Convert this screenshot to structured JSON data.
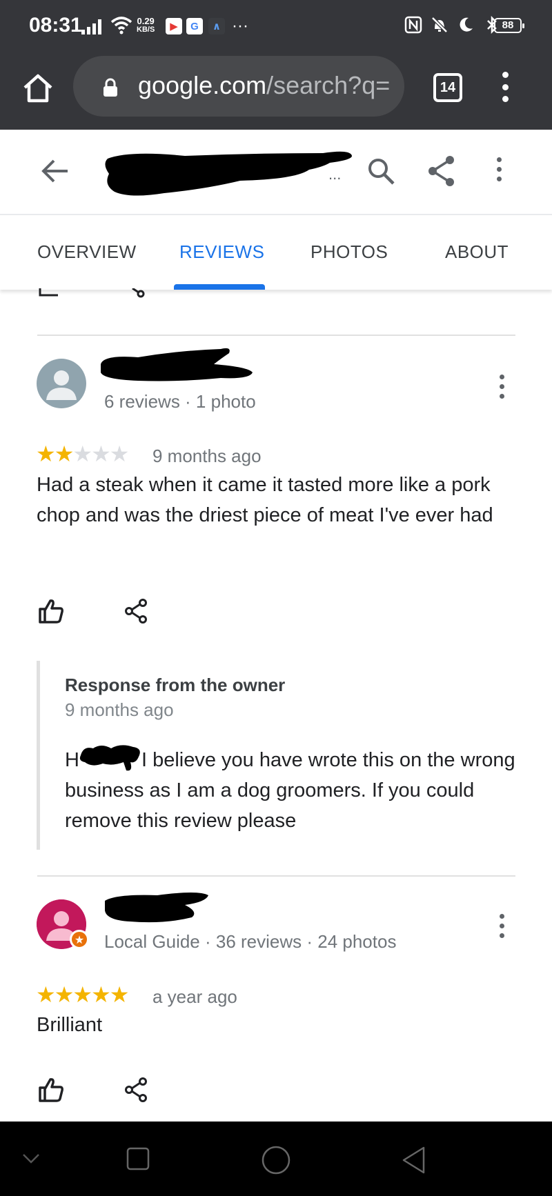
{
  "status_bar": {
    "time": "08:31",
    "speed_value": "0.29",
    "speed_unit": "KB/S",
    "more": "···",
    "battery": "88"
  },
  "browser": {
    "url_domain": "google.com",
    "url_rest": "/search?q=",
    "tab_count": "14"
  },
  "place_header": {
    "title_ellipsis": "..."
  },
  "tabs": [
    {
      "label": "OVERVIEW"
    },
    {
      "label": "REVIEWS"
    },
    {
      "label": "PHOTOS"
    },
    {
      "label": "ABOUT"
    }
  ],
  "active_tab": "REVIEWS",
  "reviews": [
    {
      "meta": "6 reviews · 1 photo",
      "rating": 2,
      "time": "9 months ago",
      "text": "Had a steak when it came it tasted more like a pork chop and was the driest piece of meat I've ever had",
      "avatar_color": "#90a4ae",
      "owner_response": {
        "title": "Response from the owner",
        "time": "9 months ago",
        "text_start": "H",
        "text_rest": "I believe you have wrote this on the wrong business as I am a dog groomers. If you could remove this review please"
      }
    },
    {
      "meta": "Local Guide · 36 reviews · 24 photos",
      "rating": 5,
      "time": "a year ago",
      "text": "Brilliant",
      "avatar_color": "#c2185b"
    }
  ],
  "colors": {
    "accent": "#1a73e8",
    "star": "#f4b400",
    "chrome_bar": "#35363a"
  }
}
